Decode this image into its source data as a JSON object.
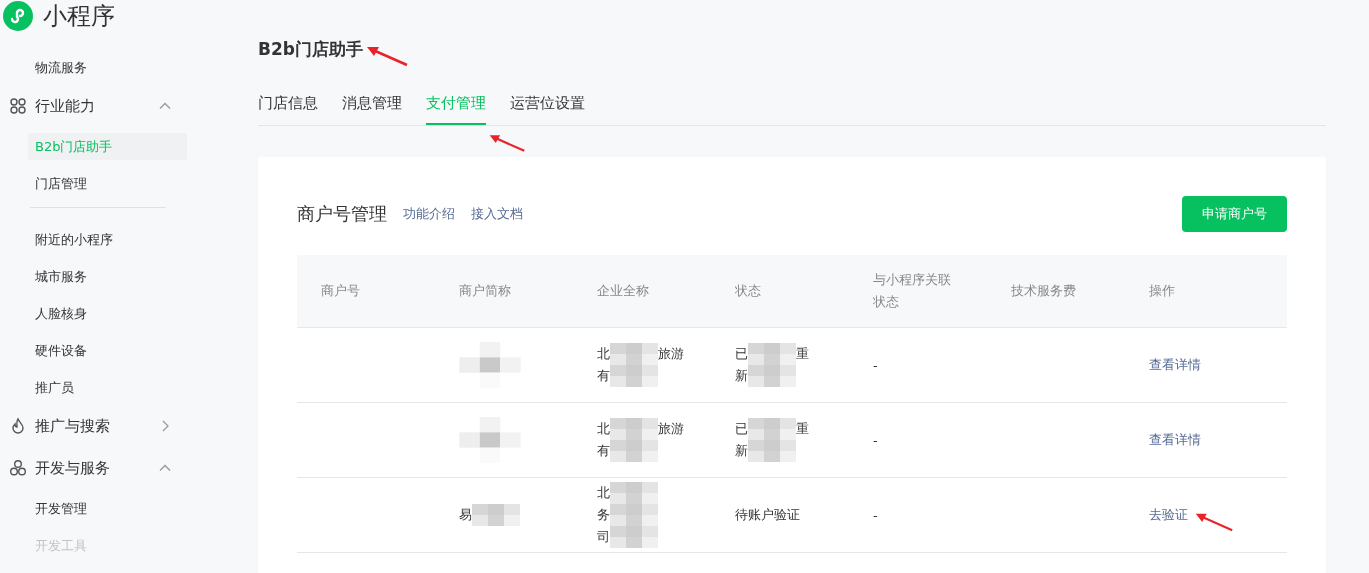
{
  "app": {
    "name": "小程序"
  },
  "sidebar": [
    {
      "kind": "item",
      "label": "物流服务",
      "selected": false,
      "disabled": false
    },
    {
      "kind": "group",
      "label": "行业能力",
      "expanded": true,
      "children": [
        {
          "kind": "item",
          "label": "B2b门店助手",
          "selected": true,
          "disabled": false
        },
        {
          "kind": "item",
          "label": "门店管理",
          "selected": false,
          "disabled": false
        },
        {
          "kind": "divider"
        },
        {
          "kind": "item",
          "label": "附近的小程序",
          "selected": false,
          "disabled": false
        },
        {
          "kind": "item",
          "label": "城市服务",
          "selected": false,
          "disabled": false
        },
        {
          "kind": "item",
          "label": "人脸核身",
          "selected": false,
          "disabled": false
        },
        {
          "kind": "item",
          "label": "硬件设备",
          "selected": false,
          "disabled": false
        },
        {
          "kind": "item",
          "label": "推广员",
          "selected": false,
          "disabled": false
        }
      ]
    },
    {
      "kind": "group",
      "label": "推广与搜索",
      "expanded": false
    },
    {
      "kind": "group",
      "label": "开发与服务",
      "expanded": true,
      "children": [
        {
          "kind": "item",
          "label": "开发管理",
          "selected": false,
          "disabled": false
        },
        {
          "kind": "item",
          "label": "开发工具",
          "selected": false,
          "disabled": true
        }
      ]
    }
  ],
  "page": {
    "title": "B2b门店助手",
    "annotated": true
  },
  "tabs": [
    {
      "label": "门店信息",
      "selected": false,
      "annotated": false
    },
    {
      "label": "消息管理",
      "selected": false,
      "annotated": false
    },
    {
      "label": "支付管理",
      "selected": true,
      "annotated": true
    },
    {
      "label": "运营位设置",
      "selected": false,
      "annotated": false
    }
  ],
  "panel": {
    "title": "商户号管理",
    "links": [
      "功能介绍",
      "接入文档"
    ],
    "button": "申请商户号"
  },
  "table": {
    "columns": [
      [
        "商户号"
      ],
      [
        "商户简称"
      ],
      [
        "企业全称"
      ],
      [
        "状态"
      ],
      [
        "与小程序关联",
        "状态"
      ],
      [
        "技术服务费"
      ],
      [
        "操作"
      ]
    ],
    "rows": [
      {
        "short_name": {
          "redacted": true
        },
        "company": {
          "redacted": true,
          "lines": [
            [
              "北",
              "旅游"
            ],
            [
              "有"
            ]
          ]
        },
        "status": {
          "redacted": true,
          "lines": [
            [
              "已",
              "重"
            ],
            [
              "新"
            ]
          ]
        },
        "link_status": "-",
        "action": "查看详情",
        "annotated": false
      },
      {
        "short_name": {
          "redacted": true
        },
        "company": {
          "redacted": true,
          "lines": [
            [
              "北",
              "旅游"
            ],
            [
              "有"
            ]
          ]
        },
        "status": {
          "redacted": true,
          "lines": [
            [
              "已",
              "重"
            ],
            [
              "新"
            ]
          ]
        },
        "link_status": "-",
        "action": "查看详情",
        "annotated": false
      },
      {
        "short_name": {
          "redacted": true,
          "lines": [
            [
              "易"
            ]
          ]
        },
        "company": {
          "redacted": true,
          "lines": [
            [
              "北"
            ],
            [
              "务"
            ],
            [
              "司"
            ]
          ]
        },
        "status": {
          "redacted": false,
          "lines": [
            [
              "待账户验证"
            ]
          ]
        },
        "link_status": "-",
        "action": "去验证",
        "annotated": true
      }
    ]
  }
}
